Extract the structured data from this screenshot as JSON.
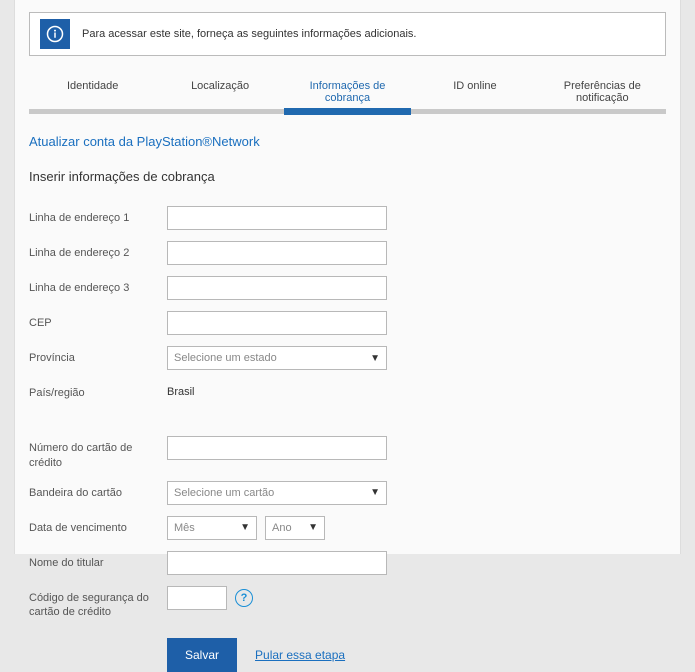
{
  "notice": {
    "message": "Para acessar este site, forneça as seguintes informações adicionais."
  },
  "tabs": [
    {
      "label": "Identidade"
    },
    {
      "label": "Localização"
    },
    {
      "label": "Informações de cobrança"
    },
    {
      "label": "ID online"
    },
    {
      "label": "Preferências de notificação"
    }
  ],
  "update_link": "Atualizar conta da PlayStation®Network",
  "section_title": "Inserir informações de cobrança",
  "form": {
    "addr1": {
      "label": "Linha de endereço 1",
      "value": ""
    },
    "addr2": {
      "label": "Linha de endereço 2",
      "value": ""
    },
    "addr3": {
      "label": "Linha de endereço 3",
      "value": ""
    },
    "cep": {
      "label": "CEP",
      "value": ""
    },
    "province": {
      "label": "Província",
      "selected": "Selecione um estado"
    },
    "country": {
      "label": "País/região",
      "value": "Brasil"
    },
    "cc_number": {
      "label": "Número do cartão de crédito",
      "value": ""
    },
    "cc_brand": {
      "label": "Bandeira do cartão",
      "selected": "Selecione um cartão"
    },
    "expiry": {
      "label": "Data de vencimento",
      "month": "Mês",
      "year": "Ano"
    },
    "holder": {
      "label": "Nome do titular",
      "value": ""
    },
    "cvv": {
      "label": "Código de segurança do cartão de crédito",
      "value": ""
    }
  },
  "actions": {
    "save": "Salvar",
    "skip": "Pular essa etapa"
  }
}
